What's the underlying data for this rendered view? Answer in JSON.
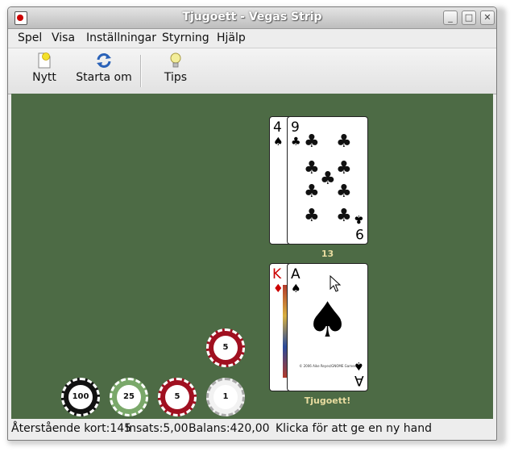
{
  "window": {
    "title": "Tjugoett - Vegas Strip"
  },
  "menu": {
    "items": [
      "Spel",
      "Visa",
      "Inställningar",
      "Styrning",
      "Hjälp"
    ]
  },
  "toolbar": {
    "new_label": "Nytt",
    "restart_label": "Starta om",
    "tips_label": "Tips"
  },
  "dealer": {
    "cards": [
      {
        "rank": "4",
        "suit": "♠"
      },
      {
        "rank": "9",
        "suit": "♣"
      }
    ],
    "total": "13"
  },
  "player": {
    "cards": [
      {
        "rank": "K",
        "suit": "♦"
      },
      {
        "rank": "A",
        "suit": "♠"
      }
    ],
    "result": "Tjugoett!",
    "card_copyright": "© 2006 Aike Reyes/GNOME Games"
  },
  "chips": [
    {
      "value": "5",
      "color": "#a01020"
    },
    {
      "value": "100",
      "color": "#111111"
    },
    {
      "value": "25",
      "color": "#7aa86a"
    },
    {
      "value": "5",
      "color": "#a01020"
    },
    {
      "value": "1",
      "color": "#f2f2f2"
    }
  ],
  "status": {
    "remaining": "Återstående kort:145",
    "bet": "Insats:5,00",
    "balance": "Balans:420,00",
    "message": "Klicka för att ge en ny hand"
  },
  "colors": {
    "felt": "#4d6b45",
    "title_text": "#ffffff"
  }
}
